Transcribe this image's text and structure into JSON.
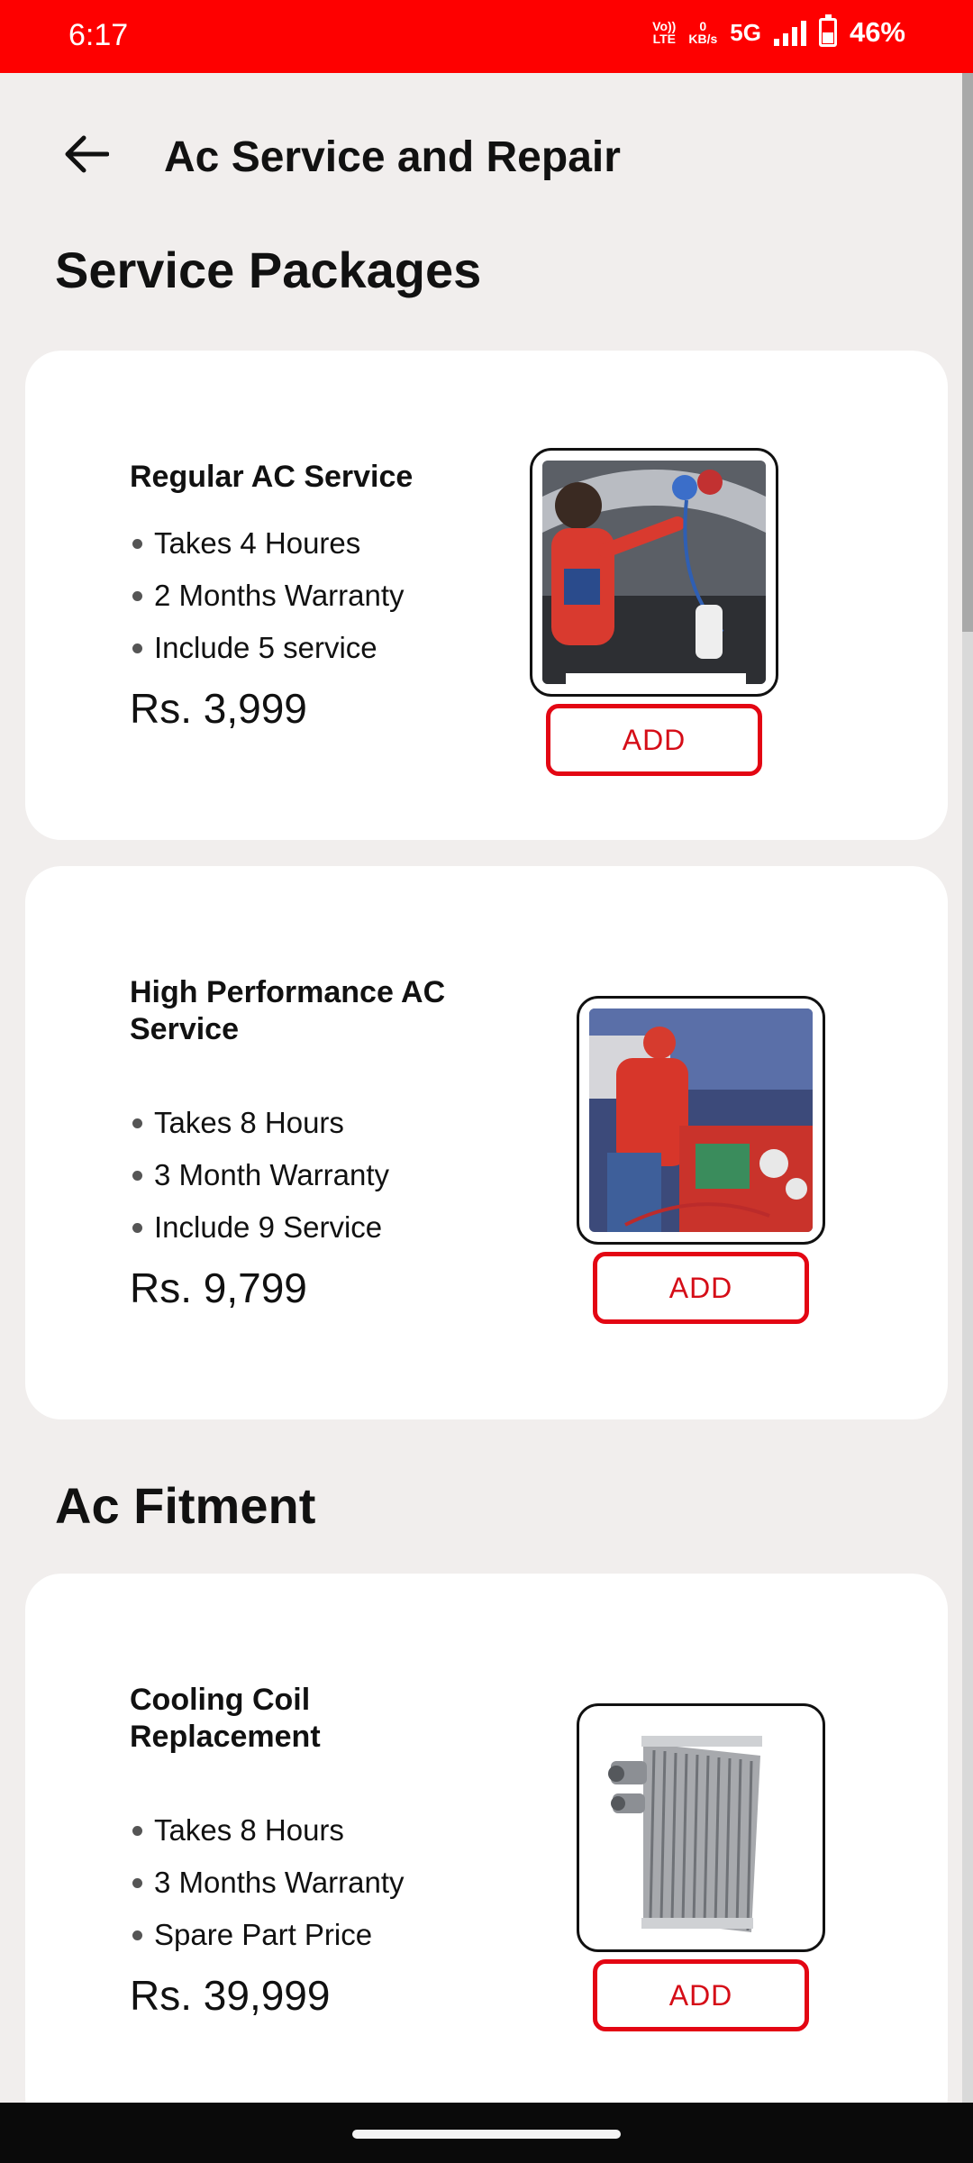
{
  "status_bar": {
    "time": "6:17",
    "volte_line1": "Vo))",
    "volte_line2": "LTE",
    "speed_value": "0",
    "speed_unit": "KB/s",
    "network": "5G",
    "battery": "46%"
  },
  "header": {
    "title": "Ac Service and Repair",
    "back_icon": "arrow-left-icon"
  },
  "sections": [
    {
      "title": "Service Packages",
      "items": [
        {
          "name": "Regular AC Service",
          "features": [
            "Takes 4 Houres",
            "2 Months Warranty",
            "Include 5 service"
          ],
          "price": "Rs. 3,999",
          "button": "ADD",
          "image": "mechanic-checking-car-ac-gauges"
        },
        {
          "name": "High Performance AC Service",
          "features": [
            "Takes 8 Hours",
            "3 Month Warranty",
            "Include 9 Service"
          ],
          "price": "Rs. 9,799",
          "button": "ADD",
          "image": "mechanic-with-ac-recharge-machine"
        }
      ]
    },
    {
      "title": "Ac Fitment",
      "items": [
        {
          "name": "Cooling Coil Replacement",
          "features": [
            "Takes 8 Hours",
            "3 Months Warranty",
            "Spare Part Price"
          ],
          "price": "Rs. 39,999",
          "button": "ADD",
          "image": "evaporator-cooling-coil"
        }
      ]
    }
  ],
  "colors": {
    "status_bar": "#fe0000",
    "accent": "#e30613",
    "background": "#f1eeed",
    "card": "#ffffff"
  }
}
